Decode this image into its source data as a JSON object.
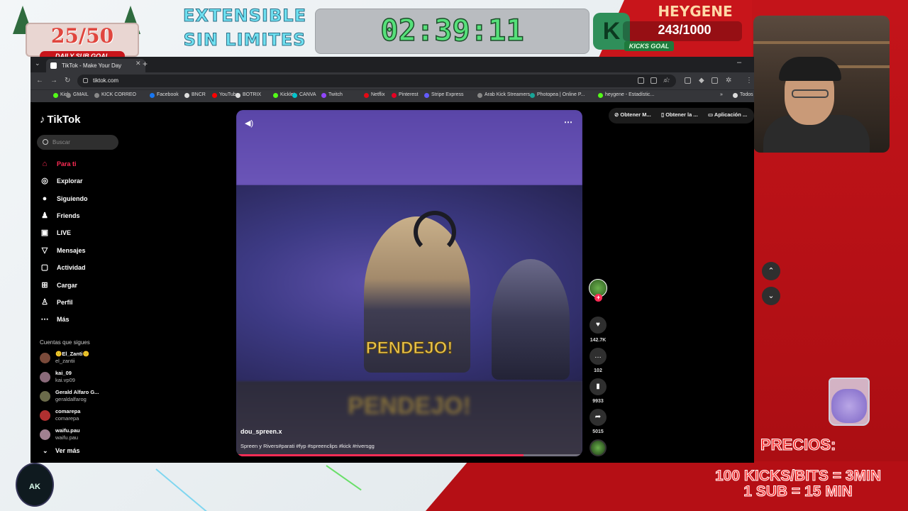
{
  "overlay": {
    "sub_goal_count": "25/50",
    "sub_goal_label": "DAILY SUB GOAL",
    "extensible_line1": "EXTENSIBLE",
    "extensible_line2": "SIN LIMITES",
    "timer": "02:39:11",
    "streamer_name": "HEYGENE",
    "kicks_count": "243/1000",
    "kicks_goal_label": "KICKS GOAL",
    "kick_logo_letter": "K",
    "precios_title": "PRECIOS:",
    "price_line1": "100 KICKS/BITS = 3MIN",
    "price_line2": "1 SUB = 15 MIN",
    "ak_logo": "AK",
    "accent_red": "#c8151b"
  },
  "browser": {
    "tab_title": "TikTok - Make Your Day",
    "tabs_menu_icon": "chevron-down-icon",
    "new_tab_icon": "plus-icon",
    "url": "tiktok.com",
    "bookmarks": [
      {
        "label": "Kick",
        "color": "#53fc18"
      },
      {
        "label": "GMAIL",
        "color": "#888888"
      },
      {
        "label": "KICK CORREO",
        "color": "#888888"
      },
      {
        "label": "Facebook",
        "color": "#1877f2"
      },
      {
        "label": "BNCR",
        "color": "#dddddd"
      },
      {
        "label": "YouTube",
        "color": "#ff0000"
      },
      {
        "label": "BOTRIX",
        "color": "#dddddd"
      },
      {
        "label": "Kicklet",
        "color": "#53fc18"
      },
      {
        "label": "CANVA",
        "color": "#00c4cc"
      },
      {
        "label": "Twitch",
        "color": "#9146ff"
      },
      {
        "label": "Netflix",
        "color": "#e50914"
      },
      {
        "label": "Pinterest",
        "color": "#e60023"
      },
      {
        "label": "Stripe Express",
        "color": "#635bff"
      },
      {
        "label": "Arab Kick Streamers...",
        "color": "#888888"
      },
      {
        "label": "Photopea | Online P...",
        "color": "#18a497"
      },
      {
        "label": "heygene - Estadístic...",
        "color": "#53fc18"
      },
      {
        "label": "Todos",
        "color": "#dddddd"
      }
    ]
  },
  "tiktok": {
    "logo": "TikTok",
    "search_placeholder": "Buscar",
    "nav": [
      {
        "label": "Para ti",
        "icon": "home-icon",
        "glyph": "⌂",
        "active": true
      },
      {
        "label": "Explorar",
        "icon": "compass-icon",
        "glyph": "◎",
        "active": false
      },
      {
        "label": "Siguiendo",
        "icon": "following-icon",
        "glyph": "●",
        "active": false
      },
      {
        "label": "Friends",
        "icon": "friends-icon",
        "glyph": "♟",
        "active": false
      },
      {
        "label": "LIVE",
        "icon": "live-icon",
        "glyph": "▣",
        "active": false
      },
      {
        "label": "Mensajes",
        "icon": "messages-icon",
        "glyph": "▽",
        "active": false
      },
      {
        "label": "Actividad",
        "icon": "activity-icon",
        "glyph": "▢",
        "active": false
      },
      {
        "label": "Cargar",
        "icon": "upload-icon",
        "glyph": "⊞",
        "active": false
      },
      {
        "label": "Perfil",
        "icon": "profile-icon",
        "glyph": "♙",
        "active": false
      },
      {
        "label": "Más",
        "icon": "more-icon",
        "glyph": "⋯",
        "active": false
      }
    ],
    "following_title": "Cuentas que sigues",
    "accounts": [
      {
        "name": "🙂El_Zanti🙂",
        "user": "el_zantii",
        "color": "#7a4a3a"
      },
      {
        "name": "kai_09",
        "user": "kai.vp09",
        "color": "#8a6a7a"
      },
      {
        "name": "Gerald Alfaro G...",
        "user": "geraldalfarog",
        "color": "#6a6a4a"
      },
      {
        "name": "comarepa",
        "user": "comarepa",
        "color": "#b03030"
      },
      {
        "name": "waifu.pau",
        "user": "waifu.pau",
        "color": "#a08090"
      }
    ],
    "see_more": "Ver más",
    "video": {
      "caption_text": "PENDEJO!",
      "caption_blur": "PENDEJO!",
      "author": "dou_spreen.x",
      "description": "Spreen y Rivers#parati #fyp #spreenclips #kick #riversgg",
      "progress": 0.83
    },
    "actions": {
      "likes": "142.7K",
      "comments": "102",
      "saves": "9933",
      "shares": "5015"
    },
    "top_buttons": [
      "Obtener M...",
      "Obtener la ...",
      "Aplicación ..."
    ]
  }
}
